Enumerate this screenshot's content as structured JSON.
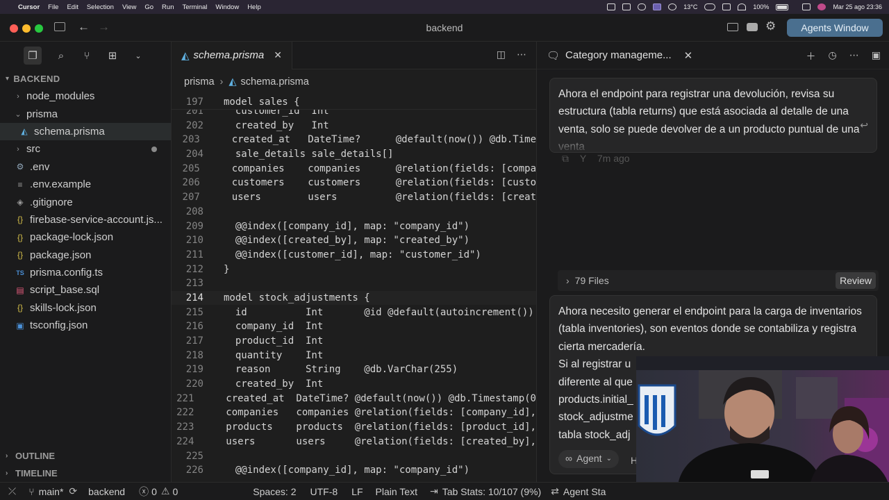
{
  "menubar": {
    "app": "Cursor",
    "items": [
      "File",
      "Edit",
      "Selection",
      "View",
      "Go",
      "Run",
      "Terminal",
      "Window",
      "Help"
    ],
    "temperature": "13°C",
    "battery": "100%",
    "datetime": "Mar 25 ago  23:36"
  },
  "window": {
    "title": "backend",
    "agents_button": "Agents Window"
  },
  "sidebar": {
    "section": "BACKEND",
    "items": [
      {
        "label": "node_modules",
        "kind": "folder",
        "expanded": false
      },
      {
        "label": "prisma",
        "kind": "folder",
        "expanded": true
      },
      {
        "label": "schema.prisma",
        "kind": "prisma",
        "selected": true
      },
      {
        "label": "src",
        "kind": "folder",
        "expanded": false
      },
      {
        "label": ".env",
        "kind": "gear"
      },
      {
        "label": ".env.example",
        "kind": "lines"
      },
      {
        "label": ".gitignore",
        "kind": "git"
      },
      {
        "label": "firebase-service-account.js...",
        "kind": "json"
      },
      {
        "label": "package-lock.json",
        "kind": "json"
      },
      {
        "label": "package.json",
        "kind": "json"
      },
      {
        "label": "prisma.config.ts",
        "kind": "ts"
      },
      {
        "label": "script_base.sql",
        "kind": "sql"
      },
      {
        "label": "skills-lock.json",
        "kind": "json"
      },
      {
        "label": "tsconfig.json",
        "kind": "tsconfig"
      }
    ],
    "outline": "OUTLINE",
    "timeline": "TIMELINE"
  },
  "editor": {
    "tab": "schema.prisma",
    "breadcrumb": [
      "prisma",
      "schema.prisma"
    ],
    "sticky": {
      "num": "197",
      "text": "model sales {"
    },
    "lines": [
      {
        "num": "201",
        "text": "  customer_id  Int"
      },
      {
        "num": "202",
        "text": "  created_by   Int"
      },
      {
        "num": "203",
        "text": "  created_at   DateTime?      @default(now()) @db.Time"
      },
      {
        "num": "204",
        "text": "  sale_details sale_details[]"
      },
      {
        "num": "205",
        "text": "  companies    companies      @relation(fields: [compa"
      },
      {
        "num": "206",
        "text": "  customers    customers      @relation(fields: [custo"
      },
      {
        "num": "207",
        "text": "  users        users          @relation(fields: [creat"
      },
      {
        "num": "208",
        "text": ""
      },
      {
        "num": "209",
        "text": "  @@index([company_id], map: \"company_id\")"
      },
      {
        "num": "210",
        "text": "  @@index([created_by], map: \"created_by\")"
      },
      {
        "num": "211",
        "text": "  @@index([customer_id], map: \"customer_id\")"
      },
      {
        "num": "212",
        "text": "}"
      },
      {
        "num": "213",
        "text": ""
      },
      {
        "num": "214",
        "text": "model stock_adjustments {"
      },
      {
        "num": "215",
        "text": "  id          Int       @id @default(autoincrement())"
      },
      {
        "num": "216",
        "text": "  company_id  Int"
      },
      {
        "num": "217",
        "text": "  product_id  Int"
      },
      {
        "num": "218",
        "text": "  quantity    Int"
      },
      {
        "num": "219",
        "text": "  reason      String    @db.VarChar(255)"
      },
      {
        "num": "220",
        "text": "  created_by  Int"
      },
      {
        "num": "221",
        "text": "  created_at  DateTime? @default(now()) @db.Timestamp(0"
      },
      {
        "num": "222",
        "text": "  companies   companies @relation(fields: [company_id],"
      },
      {
        "num": "223",
        "text": "  products    products  @relation(fields: [product_id],"
      },
      {
        "num": "224",
        "text": "  users       users     @relation(fields: [created_by],"
      },
      {
        "num": "225",
        "text": ""
      },
      {
        "num": "226",
        "text": "  @@index([company_id], map: \"company_id\")"
      }
    ],
    "current_line": "214"
  },
  "chat": {
    "title": "Category manageme...",
    "message1": "Ahora el endpoint para registrar una devolución, revisa su estructura (tabla returns) que está asociada al detalle de una venta, solo se puede devolver de a un producto puntual de una venta",
    "message1_meta": "7m ago",
    "files": "79 Files",
    "review": "Review",
    "message2_lines": [
      "Ahora necesito generar el endpoint para la carga de inventarios (tabla inventories), son eventos donde se contabiliza y registra cierta mercadería.",
      "Si al registrar u",
      "diferente al que",
      "products.initial_",
      "stock_adjustme",
      "tabla stock_adj"
    ],
    "mode": "Agent",
    "trailing": "H"
  },
  "statusbar": {
    "branch": "main*",
    "folder": "backend",
    "errors": "0",
    "warnings": "0",
    "spaces": "Spaces: 2",
    "encoding": "UTF-8",
    "eol": "LF",
    "language": "Plain Text",
    "tab_stats": "Tab Stats: 10/107 (9%)",
    "agent_stats": "Agent Sta"
  },
  "colors": {
    "accent": "#4a6f8f",
    "prisma_icon": "#5fb0e0",
    "modified_dot": "#8a8a8a"
  }
}
